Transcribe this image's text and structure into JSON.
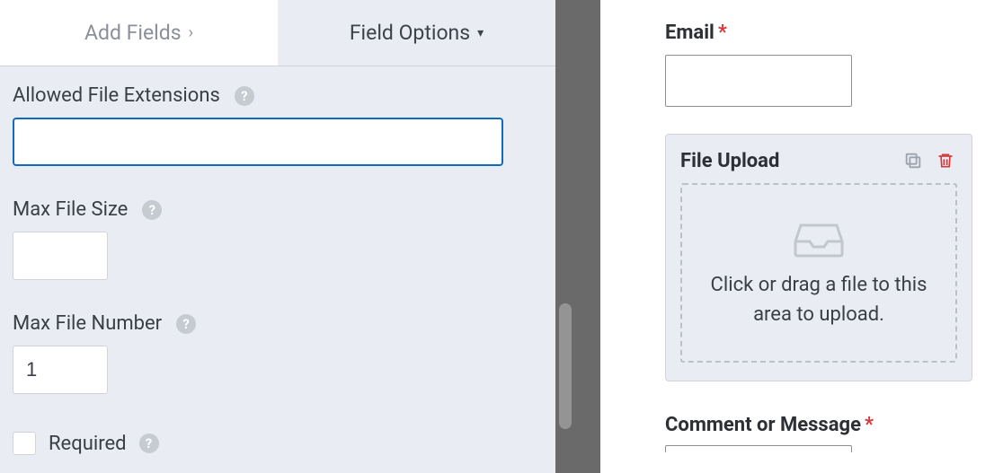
{
  "tabs": {
    "add_fields": "Add Fields",
    "field_options": "Field Options"
  },
  "options": {
    "allowed_ext_label": "Allowed File Extensions",
    "allowed_ext_value": "",
    "max_size_label": "Max File Size",
    "max_size_value": "",
    "max_number_label": "Max File Number",
    "max_number_value": "1",
    "required_label": "Required"
  },
  "preview": {
    "email_label": "Email",
    "file_upload_label": "File Upload",
    "dropzone_text": "Click or drag a file to this area to upload.",
    "comment_label": "Comment or Message"
  },
  "icons": {
    "help": "?",
    "required_mark": "*"
  }
}
